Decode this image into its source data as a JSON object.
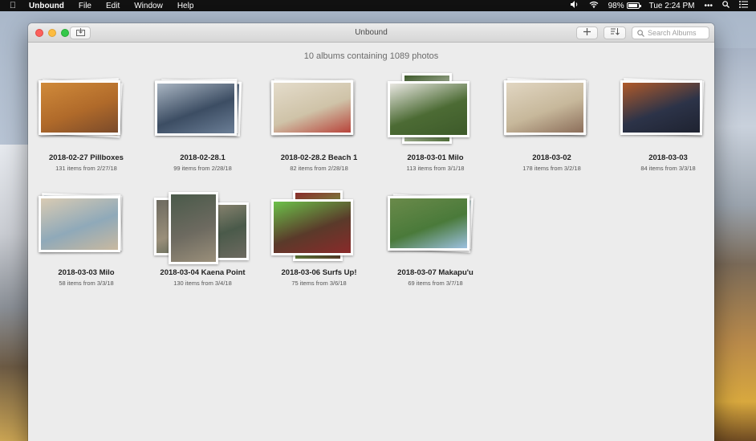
{
  "menubar": {
    "apple_icon": "apple-logo-icon",
    "app_name": "Unbound",
    "menus": [
      "File",
      "Edit",
      "Window",
      "Help"
    ],
    "battery": "98%",
    "clock": "Tue 2:24 PM"
  },
  "window": {
    "title": "Unbound",
    "search_placeholder": "Search Albums",
    "summary": "10 albums containing 1089 photos"
  },
  "albums": [
    {
      "title": "2018-02-27 Pillboxes",
      "meta": "131 items from 2/27/18",
      "colors": [
        "#b06a2a",
        "#7a4a2a",
        "#d08a3a"
      ]
    },
    {
      "title": "2018-02-28.1",
      "meta": "99 items from 2/28/18",
      "colors": [
        "#3c4d63",
        "#6b7e96",
        "#a9b5c2"
      ]
    },
    {
      "title": "2018-02-28.2 Beach 1",
      "meta": "82 items from 2/28/18",
      "colors": [
        "#cfc3a8",
        "#b8433a",
        "#e4dccb"
      ]
    },
    {
      "title": "2018-03-01 Milo",
      "meta": "113 items from 3/1/18",
      "colors": [
        "#3d5a2a",
        "#e9e7e2",
        "#4c6b34"
      ]
    },
    {
      "title": "2018-03-02",
      "meta": "178 items from 3/2/18",
      "colors": [
        "#c7b89b",
        "#8c6e5a",
        "#e1d6c2"
      ]
    },
    {
      "title": "2018-03-03",
      "meta": "84 items from 3/3/18",
      "colors": [
        "#1e2230",
        "#b05a2a",
        "#2c3348"
      ]
    },
    {
      "title": "2018-03-03 Milo",
      "meta": "58 items from 3/3/18",
      "colors": [
        "#8fa9b9",
        "#c9b9a0",
        "#d9cbb3"
      ]
    },
    {
      "title": "2018-03-04 Kaena Point",
      "meta": "130 items from 3/4/18",
      "colors": [
        "#6d6a60",
        "#9a8f7a",
        "#4a5a4a"
      ]
    },
    {
      "title": "2018-03-06 Surfs Up!",
      "meta": "75 items from 3/6/18",
      "colors": [
        "#8a2a2a",
        "#6cc24a",
        "#5a3a2a"
      ]
    },
    {
      "title": "2018-03-07 Makapu'u",
      "meta": "69 items from 3/7/18",
      "colors": [
        "#4a7a3a",
        "#9cc0e0",
        "#6a8a4a"
      ]
    }
  ]
}
